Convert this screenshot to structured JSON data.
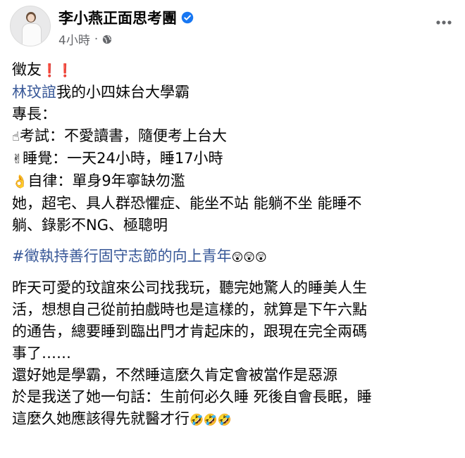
{
  "header": {
    "page_name": "李小燕正面思考團",
    "timestamp": "4小時",
    "separator": "·",
    "privacy_icon": "globe-icon",
    "verified_icon": "verified-badge-icon",
    "more_icon": "more-options-icon"
  },
  "post": {
    "l1_text": "徵友",
    "l1_emoji": "❗❗",
    "l2_tag": "林玟誼",
    "l2_text": "我的小四妹台大學霸",
    "l3": "專長：",
    "l4_emoji": "☝",
    "l4_text": "考試：不愛讀書，隨便考上台大",
    "l5_emoji": "✌",
    "l5_text": "睡覺：一天24小時，睡17小時",
    "l6_emoji": "👌",
    "l6_text": "自律：單身9年寧缺勿濫",
    "l7": "她，超宅、具人群恐懼症、能坐不站 能躺不坐 能睡不",
    "l8": "躺、錄影不NG、極聰明",
    "hashtag": "#徵執持善行固守志節的向上青年",
    "hashtag_emoji": "😲😲😲",
    "p2_l1": "昨天可愛的玟誼來公司找我玩，聽完她驚人的睡美人生",
    "p2_l2": "活，想想自己從前拍戲時也是這樣的，就算是下午六點",
    "p2_l3": "的通告，總要睡到臨出門才肯起床的，跟現在完全兩碼",
    "p2_l4": "事了……",
    "p2_l5": "還好她是學霸，不然睡這麼久肯定會被當作是惡源",
    "p2_l6": "於是我送了她一句話：生前何必久睡 死後自會長眠，睡",
    "p2_l7": "這麼久她應該得先就醫才行",
    "p2_l7_emoji": "🤣🤣🤣"
  },
  "colors": {
    "link": "#385898",
    "meta": "#65676b",
    "verified": "#1877f2",
    "exclamation": "#dd2e44"
  }
}
